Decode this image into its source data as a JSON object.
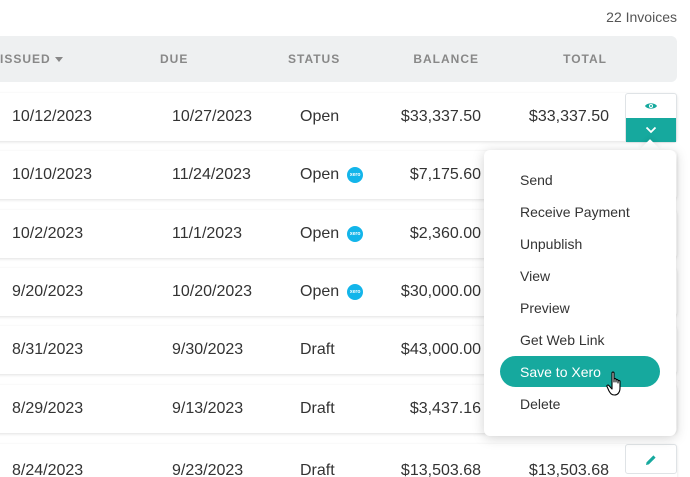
{
  "invoice_count": "22 Invoices",
  "columns": {
    "issued": "ISSUED",
    "due": "DUE",
    "status": "STATUS",
    "balance": "BALANCE",
    "total": "TOTAL"
  },
  "xero_badge_text": "xero",
  "rows": [
    {
      "issued": "10/12/2023",
      "due": "10/27/2023",
      "status": "Open",
      "xero": false,
      "balance": "$33,337.50",
      "total": "$33,337.50"
    },
    {
      "issued": "10/10/2023",
      "due": "11/24/2023",
      "status": "Open",
      "xero": true,
      "balance": "$7,175.60",
      "total": ""
    },
    {
      "issued": "10/2/2023",
      "due": "11/1/2023",
      "status": "Open",
      "xero": true,
      "balance": "$2,360.00",
      "total": ""
    },
    {
      "issued": "9/20/2023",
      "due": "10/20/2023",
      "status": "Open",
      "xero": true,
      "balance": "$30,000.00",
      "total": ""
    },
    {
      "issued": "8/31/2023",
      "due": "9/30/2023",
      "status": "Draft",
      "xero": false,
      "balance": "$43,000.00",
      "total": ""
    },
    {
      "issued": "8/29/2023",
      "due": "9/13/2023",
      "status": "Draft",
      "xero": false,
      "balance": "$3,437.16",
      "total": ""
    },
    {
      "issued": "8/24/2023",
      "due": "9/23/2023",
      "status": "Draft",
      "xero": false,
      "balance": "$13,503.68",
      "total": "$13,503.68"
    }
  ],
  "menu": {
    "items": [
      "Send",
      "Receive Payment",
      "Unpublish",
      "View",
      "Preview",
      "Get Web Link",
      "Save to Xero",
      "Delete"
    ],
    "active_item": "Save to Xero"
  },
  "colors": {
    "accent": "#16a99e",
    "xero": "#13b5ea",
    "header_bg": "#eef0f1"
  },
  "icons": {
    "row1_action": "eye-icon",
    "row1_toggle": "chevron-down-icon",
    "row7_action": "pencil-icon"
  }
}
